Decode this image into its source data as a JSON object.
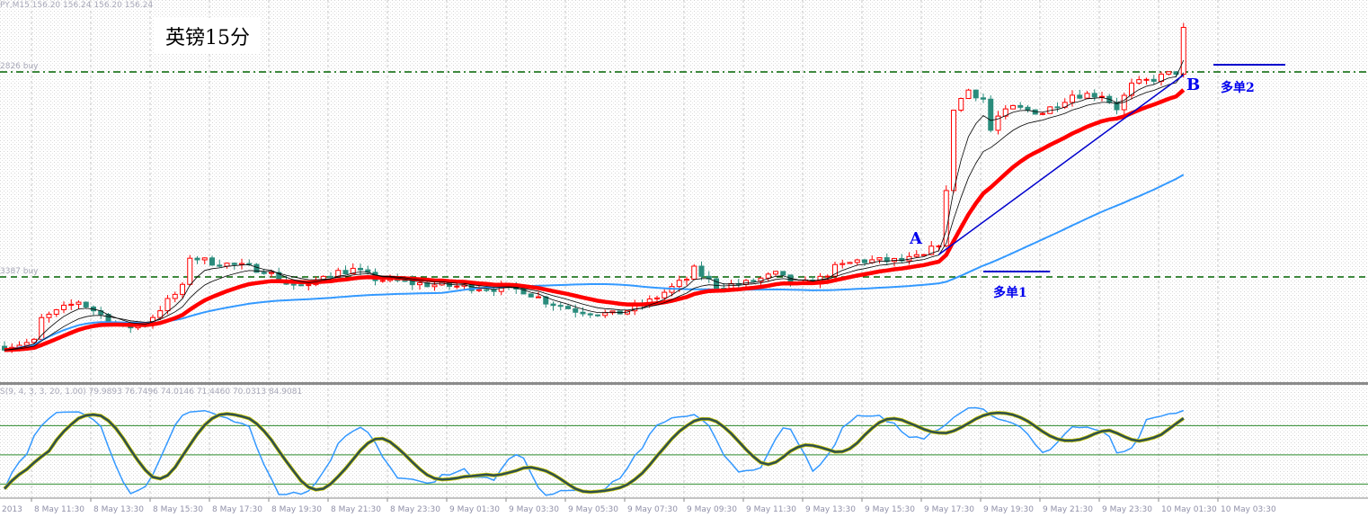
{
  "header": {
    "symbol_info": "PY,M15  156.20 156.24 156.20 156.24",
    "chart_title": "英镑15分"
  },
  "levels": [
    {
      "label": "2826 buy",
      "price": 155.82826,
      "style": "dash-dot",
      "color": "#006400"
    },
    {
      "label": "3387 buy",
      "price": 153.93387,
      "style": "dashed",
      "color": "#006400"
    }
  ],
  "annotations": {
    "point_a": "A",
    "point_b": "B",
    "order_1": "多单1",
    "order_2": "多单2",
    "trendline_from": [
      126,
      154.14
    ],
    "trendline_to": [
      159,
      155.8
    ],
    "order_1_price": 153.93,
    "order_1_bars": [
      132,
      141
    ],
    "order_2_price": 155.89,
    "order_2_bars": [
      163,
      173
    ]
  },
  "indicator": {
    "label": "S(9, 4, 3, 3, 20, 1.00) 79.9893 76.7496 74.0146 71.4460 70.0313 84.9081",
    "levels": [
      80,
      50,
      20
    ]
  },
  "colors": {
    "bull": "#ff0000",
    "bear": "#2a8c7c",
    "ma_fast": "#000000",
    "ma_mid": "#ff0000",
    "ma_slow": "#3399ff",
    "trend": "#0000cc",
    "stoch_main": "#3399ff",
    "stoch_signal": "#2f4f4f"
  },
  "chart_data": {
    "type": "candlestick",
    "title": "英镑15分",
    "timeframe": "M15",
    "x_tick_labels": [
      "2013",
      "8 May 11:30",
      "8 May 13:30",
      "8 May 15:30",
      "8 May 17:30",
      "8 May 19:30",
      "8 May 21:30",
      "8 May 23:30",
      "9 May 01:30",
      "9 May 03:30",
      "9 May 05:30",
      "9 May 07:30",
      "9 May 09:30",
      "9 May 11:30",
      "9 May 13:30",
      "9 May 15:30",
      "9 May 17:30",
      "9 May 19:30",
      "9 May 21:30",
      "9 May 23:30",
      "10 May 01:30",
      "10 May 03:30"
    ],
    "price_range": [
      152.85,
      156.48
    ],
    "close_anchors": [
      [
        0,
        153.293
      ],
      [
        4,
        153.335
      ],
      [
        5,
        153.543
      ],
      [
        10,
        153.709
      ],
      [
        13,
        153.584
      ],
      [
        16,
        153.46
      ],
      [
        19,
        153.501
      ],
      [
        22,
        153.709
      ],
      [
        24,
        153.834
      ],
      [
        25,
        154.124
      ],
      [
        27,
        154.083
      ],
      [
        31,
        154.041
      ],
      [
        35,
        154.0
      ],
      [
        38,
        153.875
      ],
      [
        41,
        153.834
      ],
      [
        43,
        153.958
      ],
      [
        47,
        154.0
      ],
      [
        50,
        153.917
      ],
      [
        55,
        153.875
      ],
      [
        60,
        153.85
      ],
      [
        65,
        153.834
      ],
      [
        70,
        153.809
      ],
      [
        73,
        153.709
      ],
      [
        77,
        153.626
      ],
      [
        82,
        153.584
      ],
      [
        84,
        153.626
      ],
      [
        87,
        153.709
      ],
      [
        89,
        153.792
      ],
      [
        92,
        153.917
      ],
      [
        93,
        154.0
      ],
      [
        96,
        153.85
      ],
      [
        100,
        153.875
      ],
      [
        104,
        153.958
      ],
      [
        107,
        153.85
      ],
      [
        110,
        153.917
      ],
      [
        112,
        154.016
      ],
      [
        115,
        154.083
      ],
      [
        117,
        154.083
      ],
      [
        121,
        154.083
      ],
      [
        124,
        154.124
      ],
      [
        126,
        154.249
      ],
      [
        127,
        154.706
      ],
      [
        128,
        155.496
      ],
      [
        130,
        155.662
      ],
      [
        132,
        155.579
      ],
      [
        133,
        155.288
      ],
      [
        134,
        155.412
      ],
      [
        136,
        155.496
      ],
      [
        140,
        155.454
      ],
      [
        144,
        155.62
      ],
      [
        148,
        155.62
      ],
      [
        150,
        155.496
      ],
      [
        152,
        155.703
      ],
      [
        156,
        155.786
      ],
      [
        158,
        155.828
      ],
      [
        159,
        156.24
      ]
    ],
    "moving_averages": [
      {
        "name": "fast",
        "period": 5
      },
      {
        "name": "mid",
        "period": 10
      },
      {
        "name": "red",
        "period": 20
      },
      {
        "name": "blue",
        "period": 60
      }
    ],
    "stochastic": {
      "k": 9,
      "d": 4,
      "slowing": 3,
      "range": [
        0,
        100
      ]
    }
  }
}
